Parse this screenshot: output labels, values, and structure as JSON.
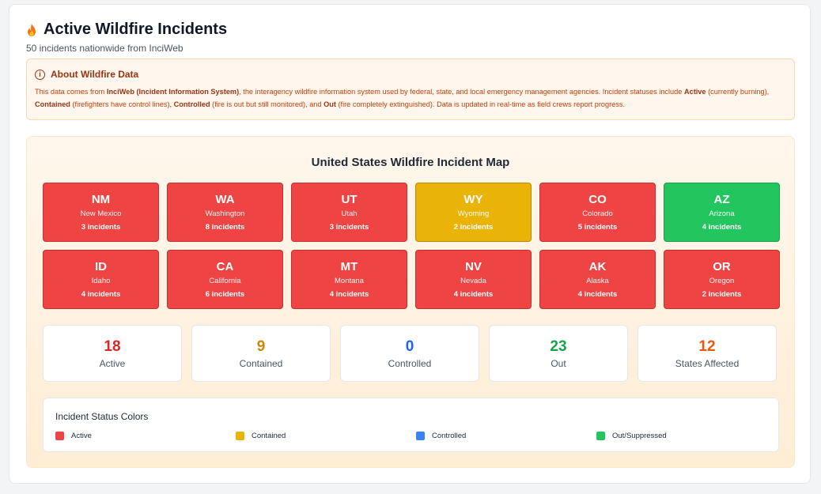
{
  "header": {
    "title": "Active Wildfire Incidents",
    "subtitle": "50 incidents nationwide from InciWeb",
    "icon": "flame-icon"
  },
  "info": {
    "title": "About Wildfire Data",
    "icon": "info-circle-icon",
    "t1": "This data comes from ",
    "b1": "InciWeb (Incident Information System)",
    "t2": ", the interagency wildfire information system used by federal, state, and local emergency management agencies. Incident statuses include ",
    "b2": "Active",
    "t3": " (currently burning), ",
    "b3": "Contained",
    "t4": " (firefighters have control lines), ",
    "b4": "Controlled",
    "t5": " (fire is out but still monitored), and ",
    "b5": "Out",
    "t6": " (fire completely extinguished). Data is updated in real-time as field crews report progress."
  },
  "map": {
    "title": "United States Wildfire Incident Map",
    "states": [
      {
        "code": "NM",
        "name": "New Mexico",
        "count": "3 incidents",
        "status": "active"
      },
      {
        "code": "WA",
        "name": "Washington",
        "count": "8 incidents",
        "status": "active"
      },
      {
        "code": "UT",
        "name": "Utah",
        "count": "3 incidents",
        "status": "active"
      },
      {
        "code": "WY",
        "name": "Wyoming",
        "count": "2 incidents",
        "status": "contained"
      },
      {
        "code": "CO",
        "name": "Colorado",
        "count": "5 incidents",
        "status": "active"
      },
      {
        "code": "AZ",
        "name": "Arizona",
        "count": "4 incidents",
        "status": "out"
      },
      {
        "code": "ID",
        "name": "Idaho",
        "count": "4 incidents",
        "status": "active"
      },
      {
        "code": "CA",
        "name": "California",
        "count": "6 incidents",
        "status": "active"
      },
      {
        "code": "MT",
        "name": "Montana",
        "count": "4 incidents",
        "status": "active"
      },
      {
        "code": "NV",
        "name": "Nevada",
        "count": "4 incidents",
        "status": "active"
      },
      {
        "code": "AK",
        "name": "Alaska",
        "count": "4 incidents",
        "status": "active"
      },
      {
        "code": "OR",
        "name": "Oregon",
        "count": "2 incidents",
        "status": "active"
      }
    ]
  },
  "stats": [
    {
      "value": "18",
      "label": "Active",
      "color": "#dc2626"
    },
    {
      "value": "9",
      "label": "Contained",
      "color": "#ca8a04"
    },
    {
      "value": "0",
      "label": "Controlled",
      "color": "#2563eb"
    },
    {
      "value": "23",
      "label": "Out",
      "color": "#16a34a"
    },
    {
      "value": "12",
      "label": "States Affected",
      "color": "#ea580c"
    }
  ],
  "legend": {
    "title": "Incident Status Colors",
    "items": [
      {
        "label": "Active",
        "color": "#ef4444"
      },
      {
        "label": "Contained",
        "color": "#eab308"
      },
      {
        "label": "Controlled",
        "color": "#3b82f6"
      },
      {
        "label": "Out/Suppressed",
        "color": "#22c55e"
      }
    ]
  }
}
